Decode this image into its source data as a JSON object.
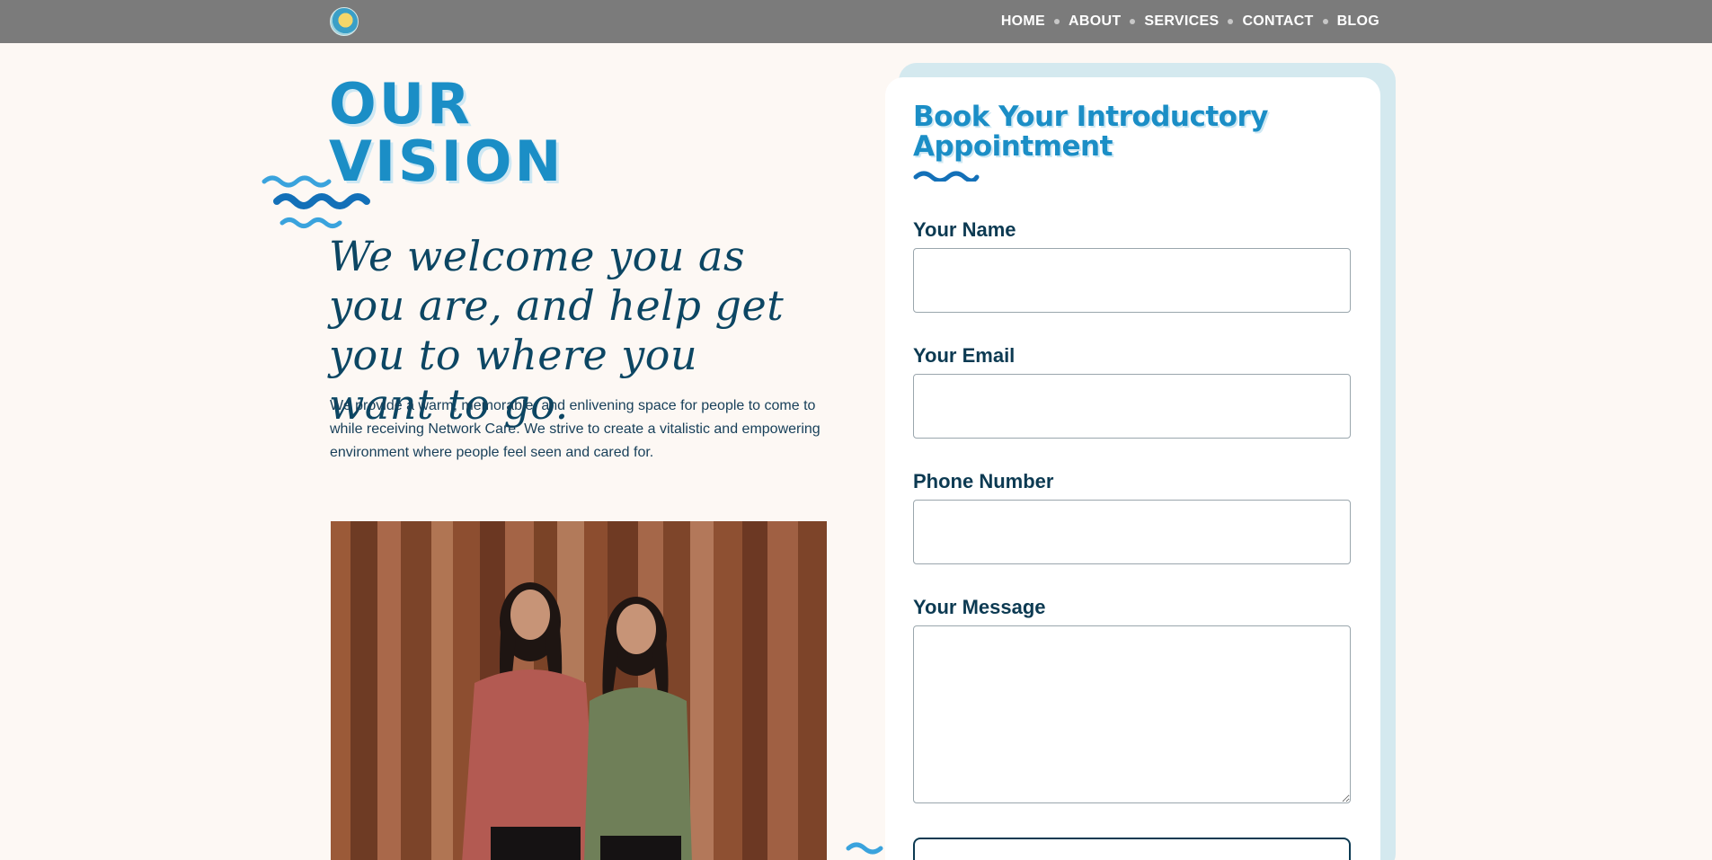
{
  "nav": {
    "logo_icon": "wave-sun-logo-icon",
    "links": [
      "HOME",
      "ABOUT",
      "SERVICES",
      "CONTACT",
      "BLOG"
    ]
  },
  "vision": {
    "title_line1": "OUR",
    "title_line2": "VISION",
    "tagline": "We welcome you as you are, and help get you to where you want to go.",
    "body": "We provide a warm, memorable, and enlivening space for people to come to while receiving Network Care. We strive to create a vitalistic and empowering environment where people feel seen and cared for."
  },
  "form": {
    "title": "Book Your Introductory Appointment",
    "name_label": "Your Name",
    "name_value": "",
    "email_label": "Your Email",
    "email_value": "",
    "phone_label": "Phone Number",
    "phone_value": "",
    "message_label": "Your Message",
    "message_value": ""
  },
  "colors": {
    "accent": "#1b8ec6",
    "navy": "#0c3a52",
    "nav_bg": "#7b7b7b",
    "page_bg": "#fdf8f4",
    "card_shadow": "#d4e9ef"
  }
}
